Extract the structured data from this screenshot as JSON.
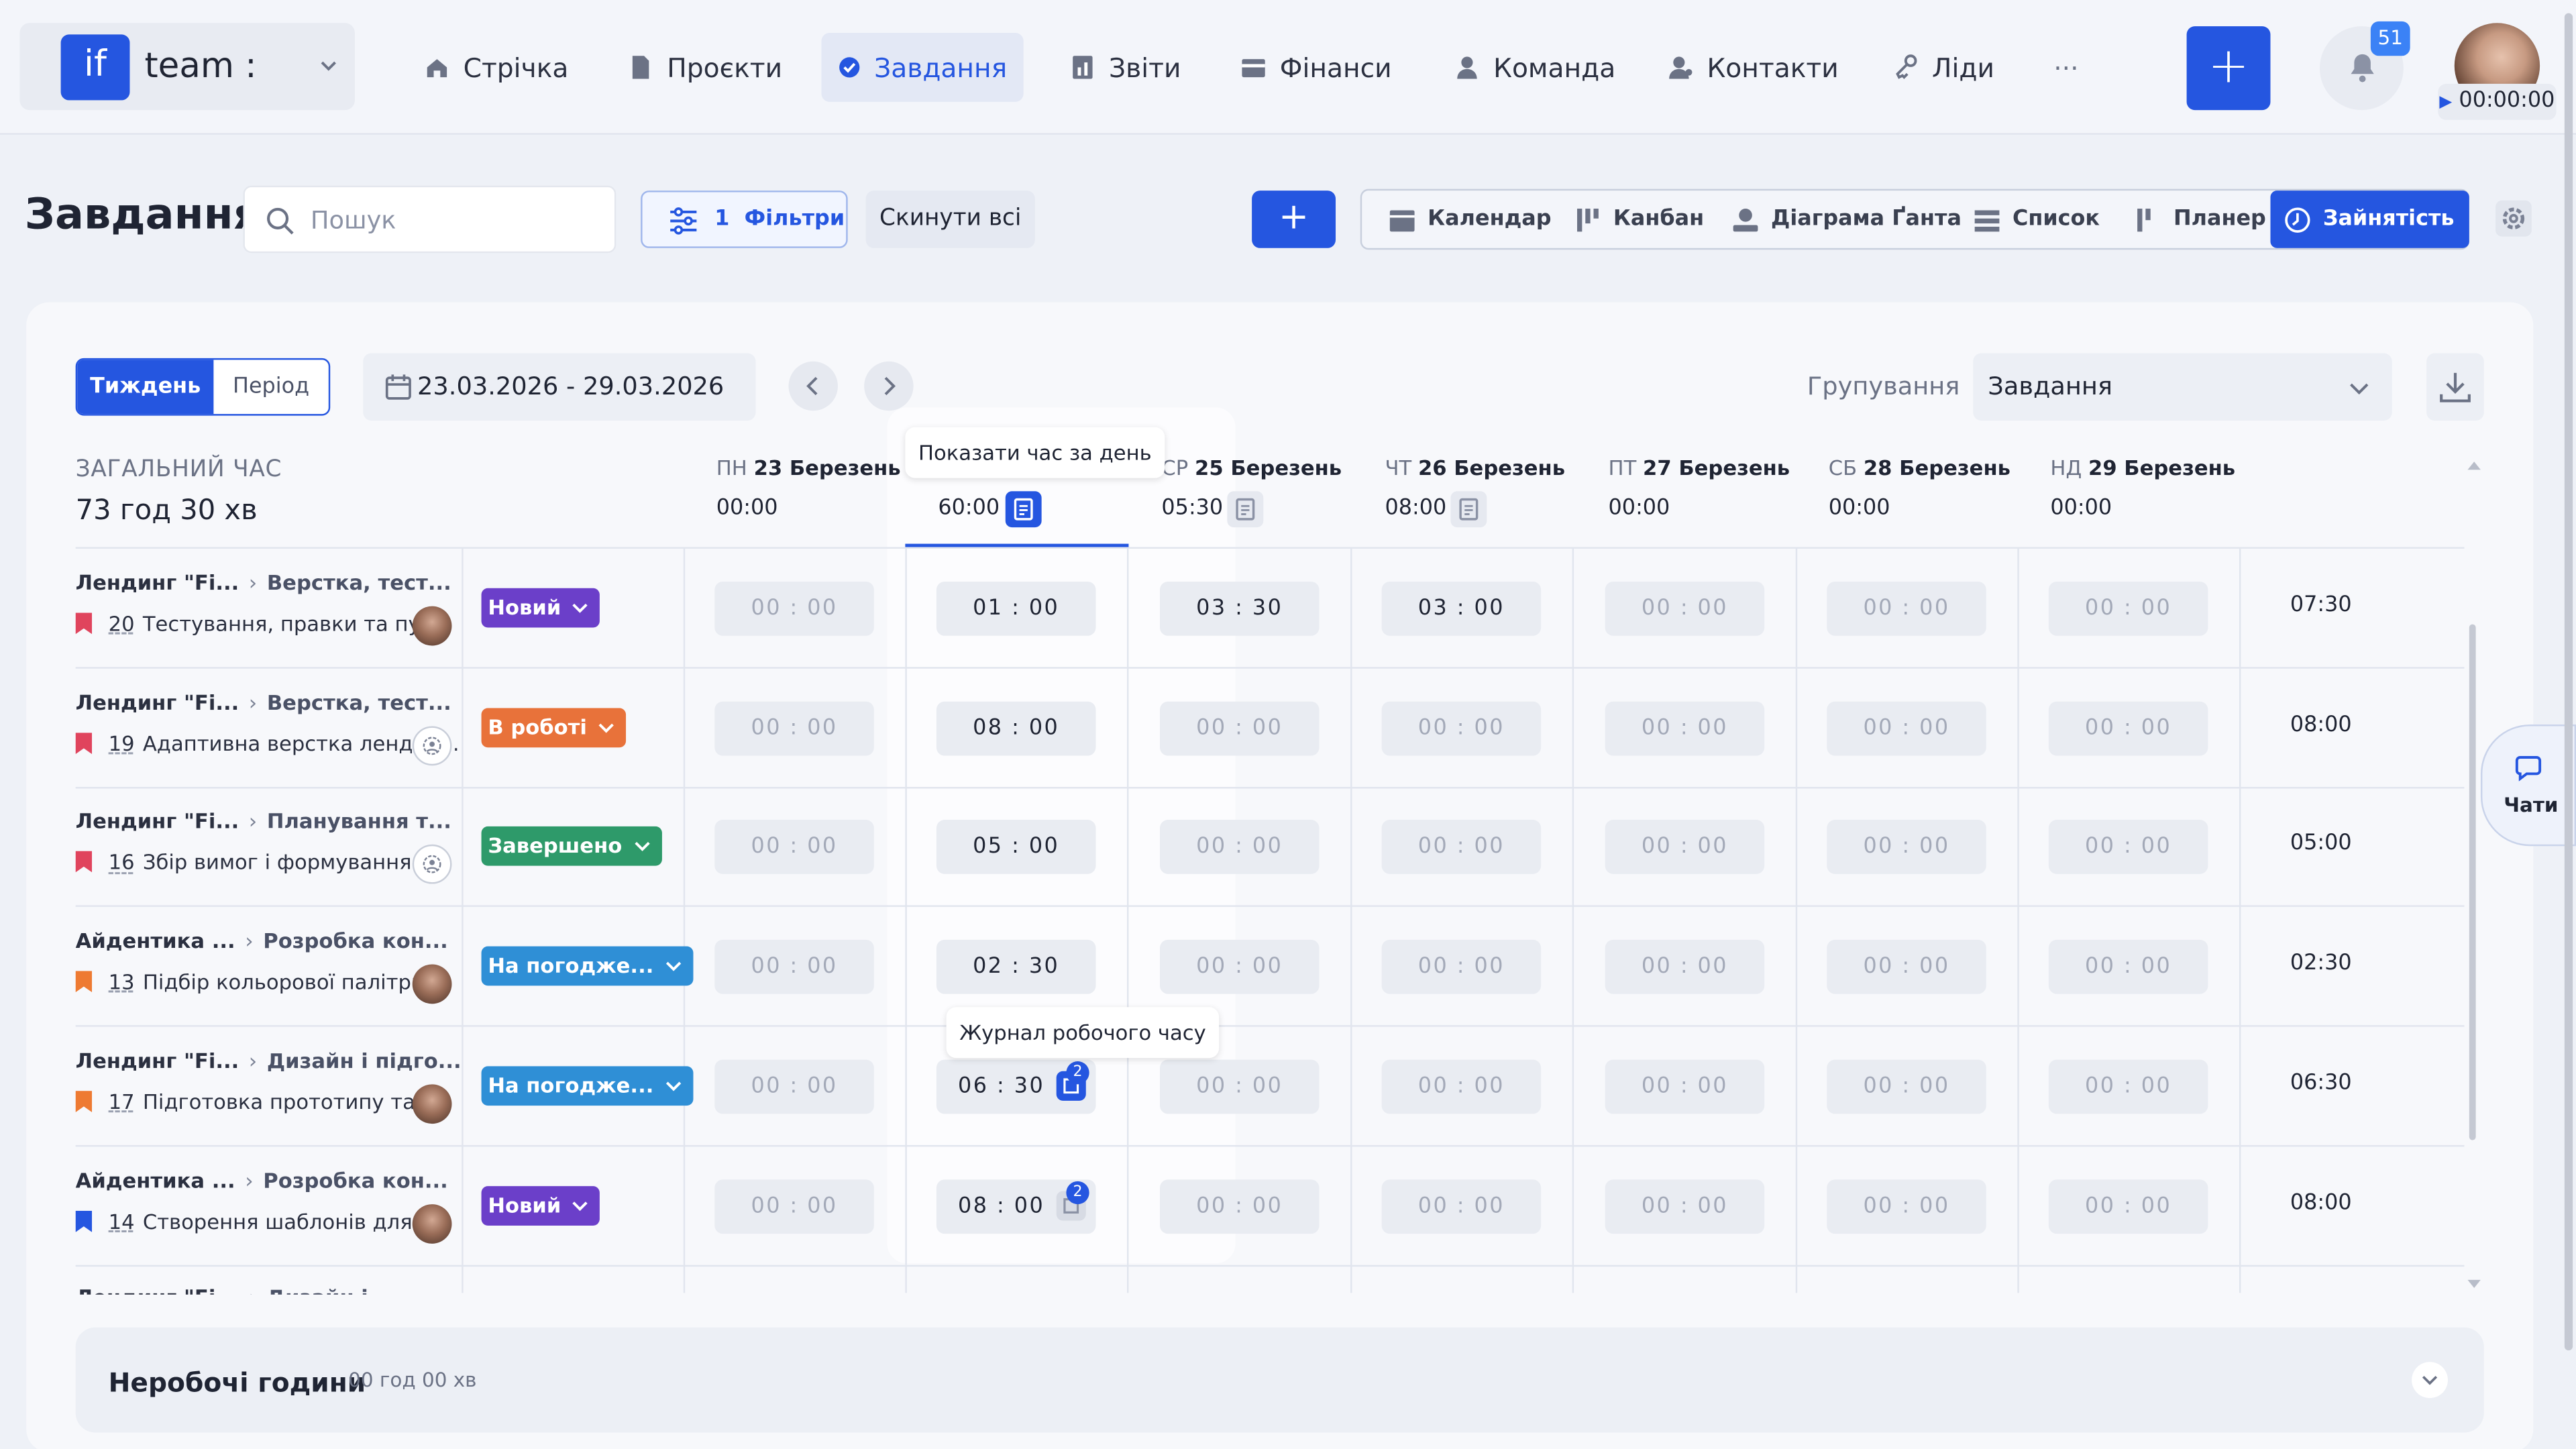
{
  "app": {
    "logo_text": "if",
    "name": "team :"
  },
  "nav": [
    {
      "label": "Стрічка",
      "icon": "home-icon"
    },
    {
      "label": "Проєкти",
      "icon": "document-icon"
    },
    {
      "label": "Завдання",
      "icon": "check-circle-icon",
      "active": true
    },
    {
      "label": "Звіти",
      "icon": "chart-icon"
    },
    {
      "label": "Фінанси",
      "icon": "wallet-icon"
    },
    {
      "label": "Команда",
      "icon": "user-icon"
    },
    {
      "label": "Контакти",
      "icon": "contacts-icon"
    },
    {
      "label": "Ліди",
      "icon": "leads-icon"
    }
  ],
  "more_label": "···",
  "add_label": "+",
  "notifications": {
    "count": "51"
  },
  "timer": {
    "value": "00:00:00"
  },
  "page": {
    "title": "Завдання",
    "search_placeholder": "Пошук",
    "filters_count": "1",
    "filters_label": "Фільтри",
    "reset_label": "Скинути всі",
    "add_label": "+"
  },
  "views": [
    {
      "label": "Календар",
      "icon": "calendar-icon"
    },
    {
      "label": "Канбан",
      "icon": "kanban-icon"
    },
    {
      "label": "Діаграма Ґанта",
      "icon": "gantt-icon"
    },
    {
      "label": "Список",
      "icon": "list-icon"
    },
    {
      "label": "Планер",
      "icon": "planner-icon"
    },
    {
      "label": "Зайнятість",
      "icon": "clock-icon",
      "active": true
    }
  ],
  "toolbar": {
    "week_label": "Тиждень",
    "period_label": "Період",
    "date_range": "23.03.2026 - 29.03.2026",
    "group_label": "Групування",
    "group_value": "Завдання"
  },
  "summary": {
    "label": "ЗАГАЛЬНИЙ ЧАС",
    "value": "73 год 30 хв"
  },
  "days": [
    {
      "dow": "ПН",
      "date": "23 Березень",
      "total": "00:00"
    },
    {
      "dow": "ВТ",
      "date": "24 Березень",
      "total": "60:00"
    },
    {
      "dow": "СР",
      "date": "25 Березень",
      "total": "05:30"
    },
    {
      "dow": "ЧТ",
      "date": "26 Березень",
      "total": "08:00"
    },
    {
      "dow": "ПТ",
      "date": "27 Березень",
      "total": "00:00"
    },
    {
      "dow": "СБ",
      "date": "28 Березень",
      "total": "00:00"
    },
    {
      "dow": "НД",
      "date": "29 Березень",
      "total": "00:00"
    }
  ],
  "tooltips": {
    "day_time": "Показати час за день",
    "work_log": "Журнал робочого часу"
  },
  "rows": [
    {
      "project": "Лендинг \"Fi...",
      "section": "Верстка, тест...",
      "num": "20",
      "title": "Тестування, правки та пу...",
      "flag_color": "#e0445d",
      "avatar": "photo",
      "status": "Новий",
      "status_color": "#6b3fc9",
      "hours": [
        "00 : 00",
        "01 : 00",
        "03 : 30",
        "03 : 00",
        "00 : 00",
        "00 : 00",
        "00 : 00"
      ],
      "total": "07:30"
    },
    {
      "project": "Лендинг \"Fi...",
      "section": "Верстка, тест...",
      "num": "19",
      "title": "Адаптивна верстка лендин...",
      "flag_color": "#e0445d",
      "avatar": "none",
      "status": "В роботі",
      "status_color": "#e8723a",
      "hours": [
        "00 : 00",
        "08 : 00",
        "00 : 00",
        "00 : 00",
        "00 : 00",
        "00 : 00",
        "00 : 00"
      ],
      "total": "08:00"
    },
    {
      "project": "Лендинг \"Fi...",
      "section": "Планування т...",
      "num": "16",
      "title": "Збір вимог і формування ...",
      "flag_color": "#e0445d",
      "avatar": "none",
      "status": "Завершено",
      "status_color": "#2e9a6a",
      "hours": [
        "00 : 00",
        "05 : 00",
        "00 : 00",
        "00 : 00",
        "00 : 00",
        "00 : 00",
        "00 : 00"
      ],
      "total": "05:00"
    },
    {
      "project": "Айдентика ...",
      "section": "Розробка кон...",
      "num": "13",
      "title": "Підбір кольорової палітри...",
      "flag_color": "#ee7a32",
      "avatar": "photo",
      "status": "На погодже...",
      "status_color": "#2f8fd6",
      "hours": [
        "00 : 00",
        "02 : 30",
        "00 : 00",
        "00 : 00",
        "00 : 00",
        "00 : 00",
        "00 : 00"
      ],
      "total": "02:30"
    },
    {
      "project": "Лендинг \"Fi...",
      "section": "Дизайн і підго...",
      "num": "17",
      "title": "Підготовка прототипу та ...",
      "flag_color": "#ee7a32",
      "avatar": "photo",
      "status": "На погодже...",
      "status_color": "#2f8fd6",
      "hours": [
        "00 : 00",
        "06 : 30",
        "00 : 00",
        "00 : 00",
        "00 : 00",
        "00 : 00",
        "00 : 00"
      ],
      "total": "06:30",
      "log_count": "2"
    },
    {
      "project": "Айдентика ...",
      "section": "Розробка кон...",
      "num": "14",
      "title": "Створення шаблонів для ...",
      "flag_color": "#2556e0",
      "avatar": "photo",
      "status": "Новий",
      "status_color": "#6b3fc9",
      "hours": [
        "00 : 00",
        "08 : 00",
        "00 : 00",
        "00 : 00",
        "00 : 00",
        "00 : 00",
        "00 : 00"
      ],
      "total": "08:00",
      "log_count": "2"
    }
  ],
  "partial_row": {
    "project": "Лендинг \"Fi...",
    "section": "Дизайн і підго..."
  },
  "offhours": {
    "title": "Неробочі години",
    "value": "00 год 00 хв"
  },
  "chat": {
    "label": "Чати"
  },
  "colors": {
    "accent": "#2556e0",
    "new": "#6b3fc9",
    "in_progress": "#e8723a",
    "done": "#2e9a6a",
    "approval": "#2f8fd6"
  }
}
